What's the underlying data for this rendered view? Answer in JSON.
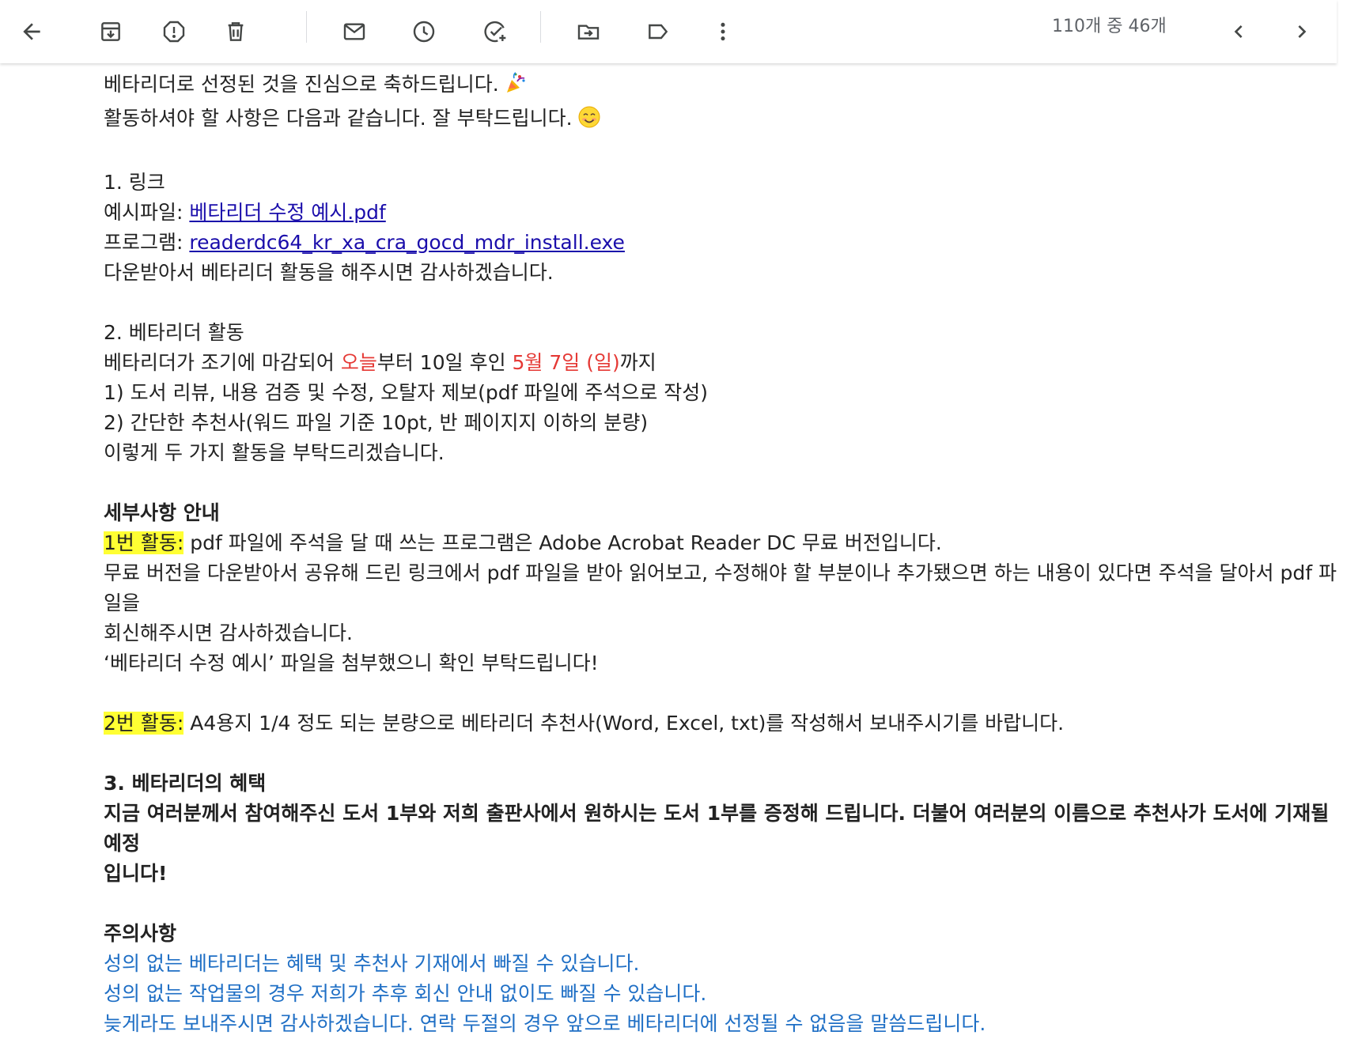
{
  "toolbar": {
    "counter": "110개 중 46개",
    "icons": [
      "back-arrow-icon",
      "archive-icon",
      "report-spam-icon",
      "delete-icon",
      "mark-unread-icon",
      "snooze-icon",
      "add-task-icon",
      "move-to-icon",
      "label-icon",
      "more-vert-icon",
      "chevron-left-icon",
      "chevron-right-icon"
    ]
  },
  "email": {
    "intro1": "베타리더로 선정된 것을 진심으로 축하드립니다.",
    "intro2": "활동하셔야 할 사항은 다음과 같습니다. 잘 부탁드립니다.",
    "s1_title": "1. 링크",
    "example_label": "예시파일: ",
    "example_link": "베타리더 수정 예시.pdf",
    "program_label": "프로그램: ",
    "program_link": "readerdc64_kr_xa_cra_gocd_mdr_install.exe",
    "download_note": "다운받아서 베타리더 활동을 해주시면 감사하겠습니다.",
    "s2_title": "2. 베타리더 활동",
    "period_a": "베타리더가 조기에 마감되어 ",
    "period_today": "오늘",
    "period_b": "부터 10일 후인 ",
    "period_date": "5월 7일 (일)",
    "period_c": "까지",
    "act1": "1) 도서 리뷰, 내용 검증 및 수정, 오탈자 제보(pdf 파일에 주석으로 작성)",
    "act2": "2) 간단한 추천사(워드 파일 기준 10pt, 반 페이지지 이하의 분량)",
    "act_end": "이렇게 두 가지 활동을 부탁드리겠습니다.",
    "details_title": "세부사항 안내",
    "a1_label": "1번 활동:",
    "a1_text": " pdf 파일에 주석을 달 때 쓰는 프로그램은 Adobe Acrobat Reader DC 무료 버전입니다.",
    "a1_desc1": "무료 버전을 다운받아서 공유해 드린 링크에서 pdf 파일을 받아 읽어보고, 수정해야 할 부분이나 추가됐으면 하는 내용이 있다면 주석을 달아서 pdf 파일을",
    "a1_desc2": "회신해주시면 감사하겠습니다.",
    "a1_desc3": "‘베타리더 수정 예시’ 파일을 첨부했으니 확인 부탁드립니다!",
    "a2_label": "2번 활동:",
    "a2_text": " A4용지 1/4 정도 되는 분량으로 베타리더 추천사(Word, Excel, txt)를 작성해서 보내주시기를 바랍니다.",
    "s3_title": "3. 베타리더의 혜택",
    "benefit1": "지금 여러분께서 참여해주신 도서 1부와 저희 출판사에서 원하시는 도서 1부를 증정해 드립니다. 더불어 여러분의 이름으로 추천사가 도서에 기재될 예정",
    "benefit2": "입니다!",
    "caution_title": "주의사항",
    "caution1": "성의 없는 베타리더는 혜택 및 추천사 기재에서 빠질 수 있습니다.",
    "caution2": "성의 없는 작업물의 경우 저희가 추후 회신 안내 없이도 빠질 수 있습니다.",
    "caution3": "늦게라도 보내주시면 감사하겠습니다. 연락 두절의 경우 앞으로 베타리더에 선정될 수 없음을 말씀드립니다."
  },
  "colors": {
    "link": "#1a0dab",
    "red": "#e53935",
    "highlight": "#ffff33",
    "caution_blue": "#1f6fc5",
    "icon_gray": "#444746"
  }
}
